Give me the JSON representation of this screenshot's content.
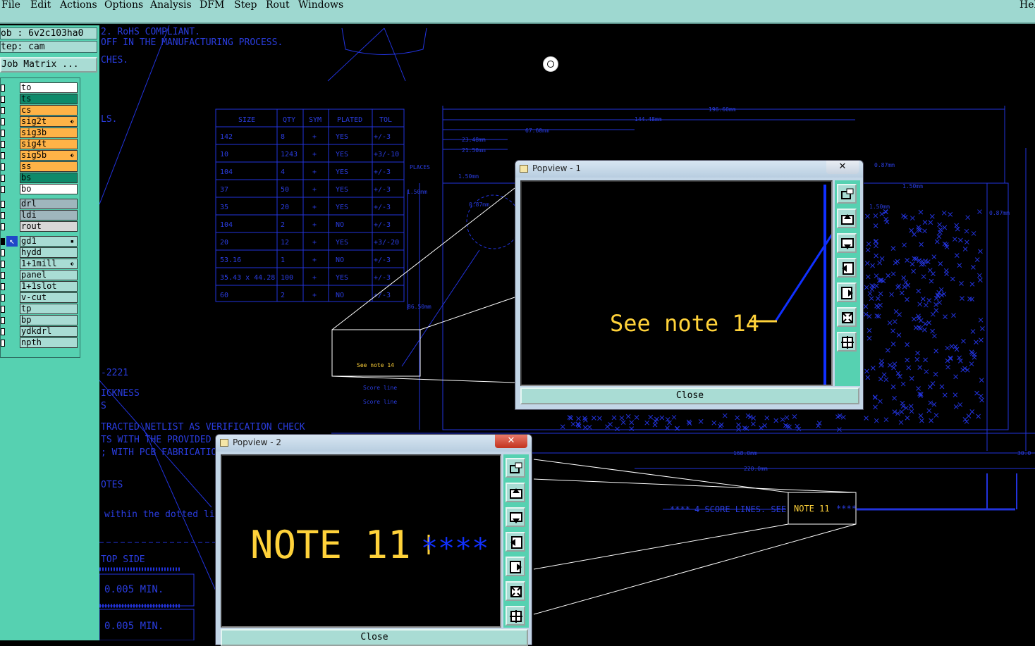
{
  "menu": [
    "File",
    "Edit",
    "Actions",
    "Options",
    "Analysis",
    "DFM",
    "Step",
    "Rout",
    "Windows",
    "Hel"
  ],
  "job_label": "ob  :  6v2c103ha0",
  "step_label": "tep: cam",
  "job_matrix_button": "Job Matrix ...",
  "layers": [
    {
      "name": "to",
      "color": "#ffffff",
      "mark": ""
    },
    {
      "name": "ts",
      "color": "#0e8a6a",
      "mark": ""
    },
    {
      "name": "cs",
      "color": "#ffb347",
      "mark": ""
    },
    {
      "name": "sig2t",
      "color": "#ffb347",
      "mark": "⬖"
    },
    {
      "name": "sig3b",
      "color": "#ffb347",
      "mark": ""
    },
    {
      "name": "sig4t",
      "color": "#ffb347",
      "mark": ""
    },
    {
      "name": "sig5b",
      "color": "#ffb347",
      "mark": "⬖"
    },
    {
      "name": "ss",
      "color": "#ffb347",
      "mark": ""
    },
    {
      "name": "bs",
      "color": "#0e8a6a",
      "mark": ""
    },
    {
      "name": "bo",
      "color": "#ffffff",
      "mark": ""
    },
    {
      "name": "drl",
      "color": "#9fb6bd",
      "mark": ""
    },
    {
      "name": "ldi",
      "color": "#9fb6bd",
      "mark": ""
    },
    {
      "name": "rout",
      "color": "#d8d8d8",
      "mark": ""
    },
    {
      "name": "gd1",
      "color": "#a9dcd4",
      "mark": "▪"
    },
    {
      "name": "hydd",
      "color": "#a9dcd4",
      "mark": ""
    },
    {
      "name": "1+1mill",
      "color": "#a9dcd4",
      "mark": "⬖"
    },
    {
      "name": "panel",
      "color": "#a9dcd4",
      "mark": ""
    },
    {
      "name": "1+1slot",
      "color": "#a9dcd4",
      "mark": ""
    },
    {
      "name": "v-cut",
      "color": "#a9dcd4",
      "mark": ""
    },
    {
      "name": "tp",
      "color": "#a9dcd4",
      "mark": ""
    },
    {
      "name": "bp",
      "color": "#a9dcd4",
      "mark": ""
    },
    {
      "name": "ydkdrl",
      "color": "#a9dcd4",
      "mark": ""
    },
    {
      "name": "npth",
      "color": "#a9dcd4",
      "mark": ""
    }
  ],
  "drawing": {
    "notes": [
      "2.  RoHS COMPLIANT.",
      "OFF IN THE MANUFACTURING PROCESS.",
      "CHES.",
      "LS.",
      "-2221",
      "ICKNESS",
      "S",
      "TRACTED NETLIST AS VERIFICATION CHECK",
      "TS WITH THE PROVIDED",
      "; WITH PCB FABRICATION",
      "OTES",
      "within the dotted line",
      "TOP SIDE",
      "0.005 MIN.",
      "0.005 MIN."
    ],
    "table_headers": [
      "SIZE",
      "QTY",
      "SYM",
      "PLATED",
      "TOL"
    ],
    "table_rows": [
      [
        "142",
        "8",
        "YES",
        "+/-3"
      ],
      [
        "10",
        "1243",
        "YES",
        "+3/-10"
      ],
      [
        "104",
        "4",
        "YES",
        "+/-3"
      ],
      [
        "37",
        "50",
        "YES",
        "+/-3"
      ],
      [
        "35",
        "20",
        "YES",
        "+/-3"
      ],
      [
        "104",
        "2",
        "NO",
        "+/-3"
      ],
      [
        "20",
        "12",
        "YES",
        "+3/-20"
      ],
      [
        "53.16",
        "1",
        "NO",
        "+/-3"
      ],
      [
        "35.43 x 44.28",
        "100",
        "YES",
        "+/-3"
      ],
      [
        "60",
        "2",
        "NO",
        "+/-3"
      ]
    ],
    "dims": [
      "196.60mm",
      "144.48mm",
      "67.60mm",
      "23.48mm",
      "21.50mm",
      "0.87mm",
      "1.50mm",
      "1.50mm",
      "1.50mm",
      "0.87mm",
      "PLACES",
      "1.50mm",
      "0.87mm",
      "86.50mm",
      "168.0mm",
      "220.0mm",
      "30.0",
      "Score line",
      "Score line"
    ],
    "zoom_note_small": "See note 14",
    "zoom_note_right": "NOTE 11",
    "score_text": "4 SCORE LINES. SEE"
  },
  "popview1": {
    "title": "Popview - 1",
    "close_x": "✕",
    "zoom_text": "See note 14",
    "close_label": "Close"
  },
  "popview2": {
    "title": "Popview - 2",
    "close_x": "✕",
    "zoom_text": "NOTE  11",
    "close_label": "Close"
  }
}
